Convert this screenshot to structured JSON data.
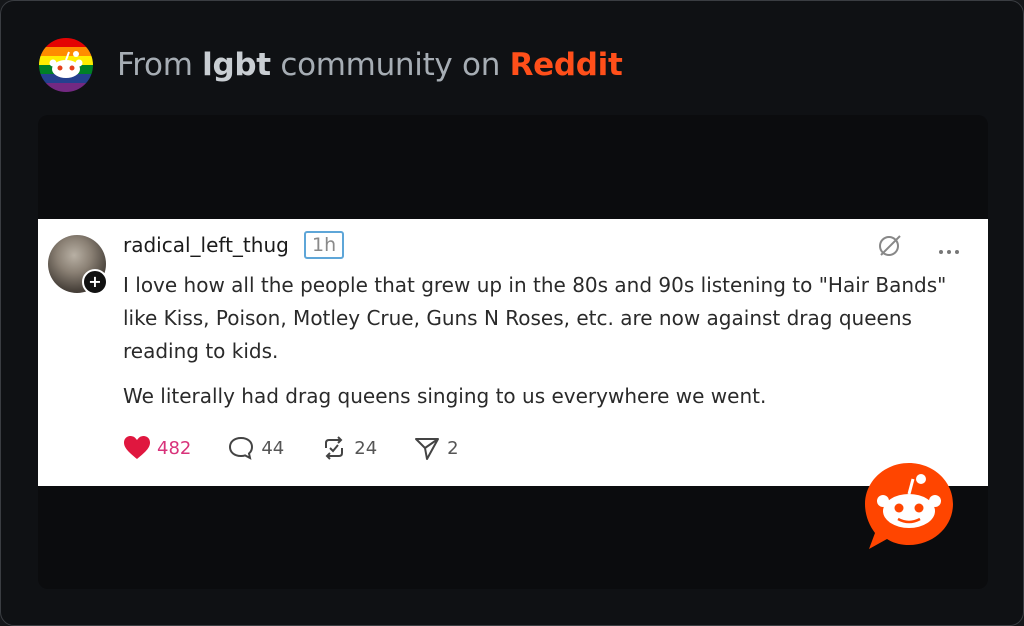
{
  "header": {
    "prefix": "From ",
    "community": "lgbt",
    "middle": " community on ",
    "platform": "Reddit",
    "avatar_icon": "rainbow-snoo-icon"
  },
  "post": {
    "username": "radical_left_thug",
    "time": "1h",
    "body": [
      "I love how all the people that grew up in the 80s and 90s listening to \"Hair Bands\" like Kiss, Poison, Motley Crue, Guns N Roses, etc. are now against drag queens reading to kids.",
      "We literally had drag queens singing to us everywhere we went."
    ],
    "likes": "482",
    "comments": "44",
    "reposts": "24",
    "shares": "2",
    "icons": [
      "mute-icon",
      "more-options-icon"
    ]
  },
  "colors": {
    "accent": "#ff4f1a",
    "like": "#d8327a"
  }
}
